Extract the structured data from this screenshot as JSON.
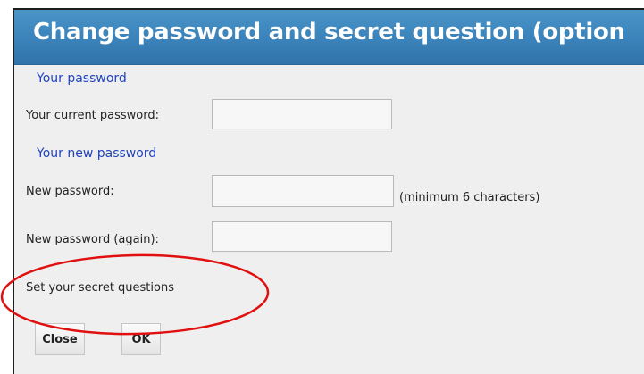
{
  "dialog": {
    "title": "Change password and secret question (option"
  },
  "sections": {
    "current_header": "Your password",
    "new_header": "Your new password"
  },
  "fields": {
    "current_password": {
      "label": "Your current password:",
      "value": ""
    },
    "new_password": {
      "label": "New password:",
      "value": "",
      "hint": "(minimum 6 characters)"
    },
    "new_password_again": {
      "label": "New password (again):",
      "value": ""
    }
  },
  "secret": {
    "label": "Set your secret questions"
  },
  "buttons": {
    "close_label": "Close",
    "ok_label": "OK"
  },
  "annotation": {
    "color": "#e01010"
  }
}
